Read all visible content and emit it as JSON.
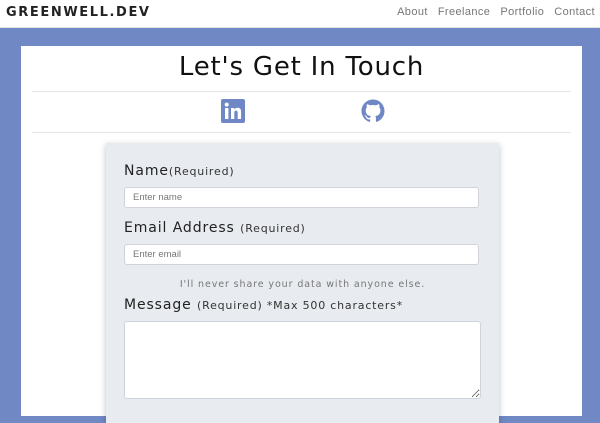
{
  "brand": "GREENWELL.DEV",
  "nav": [
    "About",
    "Freelance",
    "Portfolio",
    "Contact"
  ],
  "page_title": "Let's Get In Touch",
  "social": [
    {
      "icon": "linkedin-icon",
      "color": "#6f87c4"
    },
    {
      "icon": "github-icon",
      "color": "#6f87c4"
    }
  ],
  "form": {
    "name_label": "Name",
    "name_required": "(Required)",
    "name_placeholder": "Enter name",
    "email_label": "Email Address",
    "email_required": "(Required)",
    "email_placeholder": "Enter email",
    "email_help": "I'll never share your data with anyone else.",
    "message_label": "Message",
    "message_required": "(Required) *Max 500 characters*"
  },
  "colors": {
    "background": "#7088c4",
    "panel": "#e8ebef",
    "accent": "#6f87c4"
  }
}
